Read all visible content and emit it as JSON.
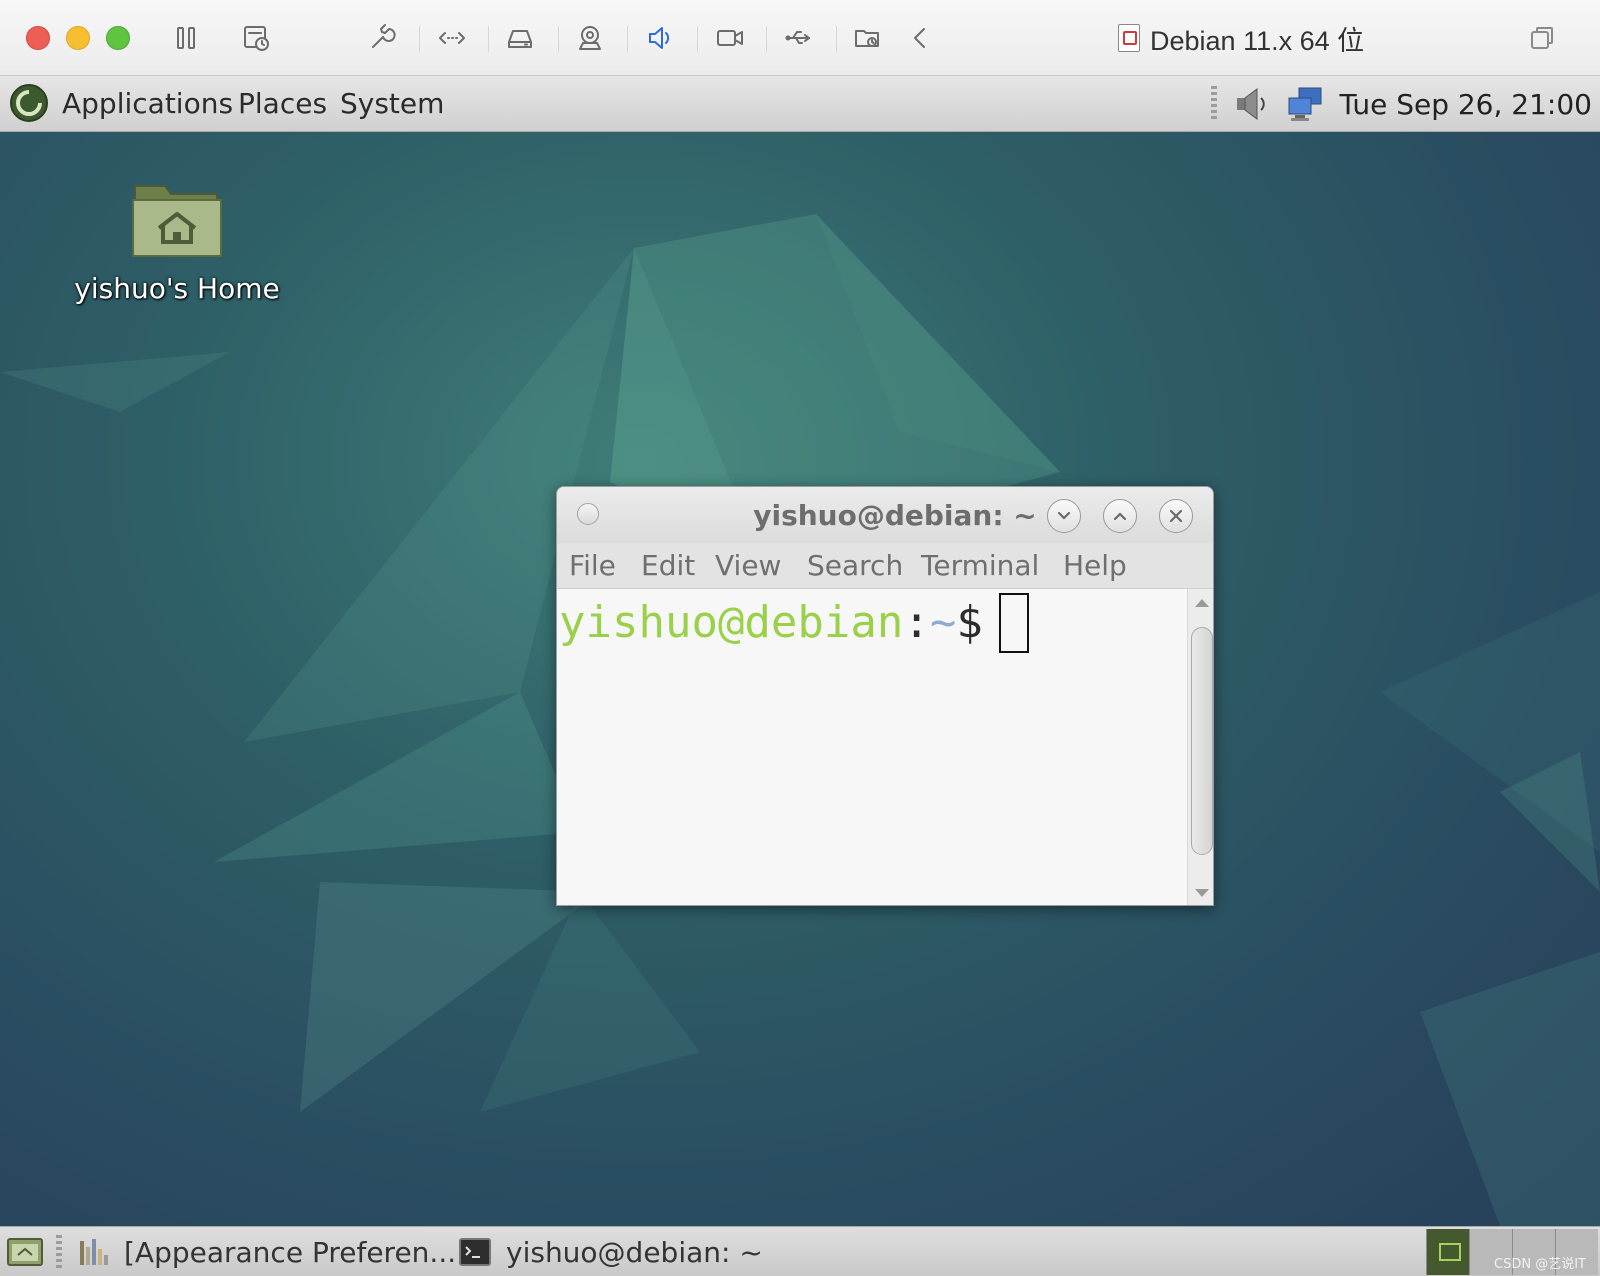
{
  "vm": {
    "title": "Debian 11.x 64 位",
    "toolbar": {
      "buttons": [
        "pause-icon",
        "snapshot-icon",
        "settings-icon",
        "network-arrows-icon",
        "hard-disk-icon",
        "camera-icon",
        "speaker-icon",
        "video-camera-icon",
        "usb-icon",
        "shared-folder-icon",
        "collapse-icon"
      ],
      "active": "speaker-icon",
      "active_color": "#2c6bd9"
    }
  },
  "top_panel": {
    "menus": [
      "Applications",
      "Places",
      "System"
    ],
    "clock": "Tue Sep 26, 21:00",
    "tray_icons": [
      "volume-icon",
      "network-icon"
    ]
  },
  "desktop": {
    "icons": [
      {
        "label": "yishuo's Home",
        "icon": "home-folder-icon"
      }
    ]
  },
  "terminal": {
    "title": "yishuo@debian: ~",
    "menus": [
      "File",
      "Edit",
      "View",
      "Search",
      "Terminal",
      "Help"
    ],
    "prompt": {
      "user": "yishuo@debian",
      "colon": ":",
      "path": "~",
      "dollar": "$"
    },
    "colors": {
      "user": "#9ad04a",
      "path": "#8faad0"
    }
  },
  "bottom_panel": {
    "tasks": [
      {
        "label": "[Appearance Preferen...",
        "icon": "appearance-icon"
      },
      {
        "label": "yishuo@debian: ~",
        "icon": "terminal-icon"
      }
    ],
    "workspaces": 4,
    "active_workspace": 1,
    "watermark": "CSDN @艺说IT"
  }
}
